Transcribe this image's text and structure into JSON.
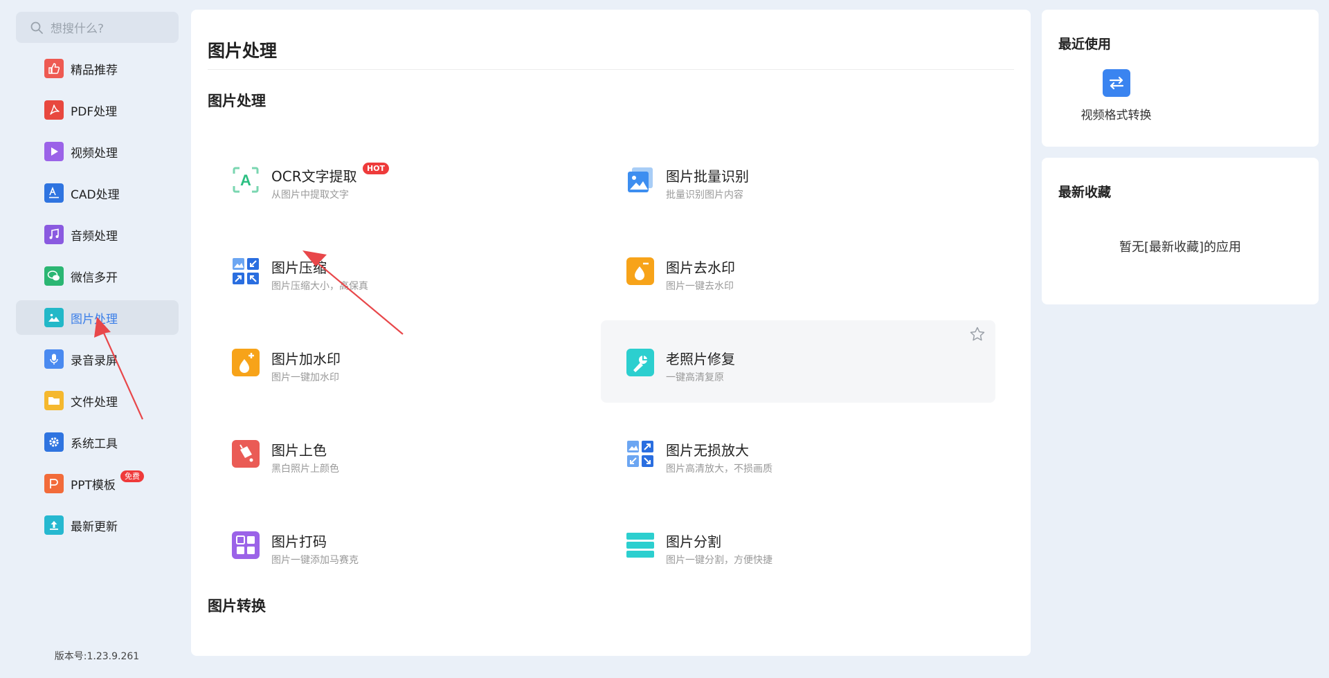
{
  "search": {
    "placeholder": "想搜什么?"
  },
  "sidebar": {
    "items": [
      {
        "label": "精品推荐",
        "icon": "thumbs-up-icon",
        "color": "#ee5a52"
      },
      {
        "label": "PDF处理",
        "icon": "pdf-icon",
        "color": "#e8483f"
      },
      {
        "label": "视频处理",
        "icon": "play-icon",
        "color": "#9b63e8"
      },
      {
        "label": "CAD处理",
        "icon": "cad-icon",
        "color": "#2f74e0"
      },
      {
        "label": "音频处理",
        "icon": "music-icon",
        "color": "#8a5ae0"
      },
      {
        "label": "微信多开",
        "icon": "wechat-icon",
        "color": "#2bb673"
      },
      {
        "label": "图片处理",
        "icon": "image-icon",
        "color": "#22b8c8",
        "active": true
      },
      {
        "label": "录音录屏",
        "icon": "microphone-icon",
        "color": "#4a8af0"
      },
      {
        "label": "文件处理",
        "icon": "folder-icon",
        "color": "#f5b82e"
      },
      {
        "label": "系统工具",
        "icon": "gear-icon",
        "color": "#2f74e0"
      },
      {
        "label": "PPT模板",
        "icon": "ppt-icon",
        "color": "#f26b3a",
        "badge": "免费"
      },
      {
        "label": "最新更新",
        "icon": "upload-icon",
        "color": "#26b8d0"
      }
    ],
    "version": "版本号:1.23.9.261"
  },
  "main": {
    "page_title": "图片处理",
    "section1": "图片处理",
    "section2": "图片转换",
    "tools": [
      {
        "name": "OCR文字提取",
        "desc": "从图片中提取文字",
        "icon": "ocr-icon",
        "badge": "HOT"
      },
      {
        "name": "图片批量识别",
        "desc": "批量识别图片内容",
        "icon": "batch-image-icon"
      },
      {
        "name": "图片压缩",
        "desc": "图片压缩大小，高保真",
        "icon": "compress-icon"
      },
      {
        "name": "图片去水印",
        "desc": "图片一键去水印",
        "icon": "remove-watermark-icon"
      },
      {
        "name": "图片加水印",
        "desc": "图片一键加水印",
        "icon": "add-watermark-icon"
      },
      {
        "name": "老照片修复",
        "desc": "一键高清复原",
        "icon": "photo-repair-icon"
      },
      {
        "name": "图片上色",
        "desc": "黑白照片上颜色",
        "icon": "colorize-icon"
      },
      {
        "name": "图片无损放大",
        "desc": "图片高清放大，不损画质",
        "icon": "enlarge-icon"
      },
      {
        "name": "图片打码",
        "desc": "图片一键添加马赛克",
        "icon": "mosaic-icon"
      },
      {
        "name": "图片分割",
        "desc": "图片一键分割，方便快捷",
        "icon": "split-icon"
      }
    ]
  },
  "recent": {
    "title": "最近使用",
    "app_label": "视频格式转换",
    "app_icon": "convert-icon"
  },
  "favorites": {
    "title": "最新收藏",
    "empty_text": "暂无[最新收藏]的应用"
  },
  "colors": {
    "accent": "#3a7ee8",
    "annotation": "#e8474a"
  }
}
